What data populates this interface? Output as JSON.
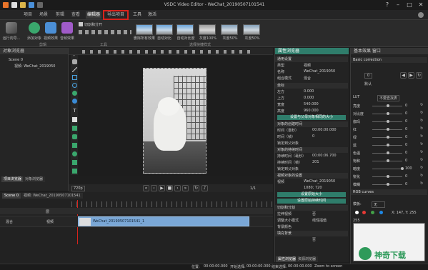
{
  "app": {
    "title": "VSDC Video Editor - WeChat_20190507101541"
  },
  "window_controls": {
    "help": "?",
    "minimize": "–",
    "maximize": "□",
    "close": "✕"
  },
  "menu": {
    "items": [
      "项目",
      "场景",
      "剪辑",
      "查看",
      "编辑器",
      "导出项目",
      "工具",
      "激活"
    ],
    "active": "编辑器",
    "highlighted": "导出项目"
  },
  "ribbon": {
    "run_label": "运行向导...",
    "add_object_label": "添加对象",
    "video_effects_label": "视频效果",
    "audio_effects_label": "音频效果",
    "edit_group": "剪辑",
    "cut_split_label": "切割和分开",
    "tools_group": "工具",
    "quick_styles": [
      "删除所有效果",
      "自动对比",
      "自动对比度",
      "灰度100%",
      "灰度50%",
      "灰度50%"
    ],
    "quick_styles_group": "选择快捷样式"
  },
  "left_panel": {
    "title": "对象浏览器",
    "tree": [
      "Scene 0",
      "视频: WeChat_2019050"
    ],
    "tabs": [
      "项目浏览器",
      "对象浏览器"
    ]
  },
  "preview": {
    "resolution": "720p",
    "page": "1/1"
  },
  "timeline": {
    "tabs": [
      "Scene 0",
      "视频: WeChat_20190507101541"
    ],
    "track_label": "混合",
    "track_name": "视频",
    "layer_label": "层",
    "clip_label": "WeChat_20190507101541_1"
  },
  "status": {
    "position_label": "位置:",
    "position_value": "00:00:00.000",
    "start_label": "开始选择:",
    "start_value": "00:00:00.000",
    "end_label": "结束选择:",
    "end_value": "00:00:00.000",
    "zoom_label": "Zoom to screen"
  },
  "properties": {
    "title": "属性浏览器",
    "common_section": "通用设置",
    "rows": [
      {
        "k": "类型",
        "v": "视频"
      },
      {
        "k": "名称",
        "v": "WeChat_2019050"
      },
      {
        "k": "组合模式",
        "v": "混合"
      }
    ],
    "coords_section": "坐标",
    "coords": [
      {
        "k": "左方",
        "v": "0.000"
      },
      {
        "k": "上方",
        "v": "0.000"
      },
      {
        "k": "宽度",
        "v": "540.000"
      },
      {
        "k": "高度",
        "v": "960.000"
      }
    ],
    "parent_btn": "设置与父母对象相同的大小",
    "object_time_section": "对象的创建时间",
    "object_time": [
      {
        "k": "时间（毫秒）",
        "v": "00:00:00.000"
      },
      {
        "k": "时间（帧）",
        "v": "0"
      }
    ],
    "duration_toggle": "锁定到父对象",
    "object_duration_section": "对象的持续时间",
    "object_duration": [
      {
        "k": "持续时间（毫秒）",
        "v": "00:00:06.700"
      },
      {
        "k": "持续时间（帧）",
        "v": "201"
      }
    ],
    "lock_label": "锁定到父对象",
    "video_settings_section": "视频对象的设置",
    "video_settings": [
      {
        "k": "视频",
        "v": "WeChat_2019050"
      },
      {
        "k": "",
        "v": "1080; 720"
      }
    ],
    "original_btn": "设置原始大小",
    "duration_btn": "设置原始持续时间",
    "cut_section": "切割和分割",
    "cut_rows": [
      {
        "k": "拉伸视频",
        "v": "否"
      },
      {
        "k": "调整大小模式",
        "v": "线性插值"
      },
      {
        "k": "背景颜色",
        "v": ""
      }
    ],
    "fill_label": "填充背景",
    "fill_value": "否",
    "tabs": [
      "属性浏览器",
      "资源浏览器"
    ]
  },
  "effects": {
    "title": "基本效果 窗口",
    "section": "Basic correction",
    "preset_label": "默认",
    "preset_value": "0",
    "lut_label": "LUT",
    "lut_value": "不要查找表",
    "adjustments": [
      "亮度",
      "对比度",
      "伽玛",
      "红",
      "绿",
      "蓝",
      "色温",
      "饱和",
      "暗度",
      "锐化",
      "模糊"
    ],
    "adjust_values": [
      0,
      0,
      0,
      0,
      0,
      0,
      0,
      0,
      100,
      0,
      0
    ],
    "rgb_section": "RGB curves",
    "curve_label": "模板:",
    "curve_value": "无",
    "color_dots": [
      "#ffffff",
      "#e53935",
      "#43a047",
      "#1e88e5"
    ],
    "xy_readout": "X: 147, Y: 255",
    "axis_y": "255"
  },
  "brand": {
    "text": "神奇下载"
  }
}
